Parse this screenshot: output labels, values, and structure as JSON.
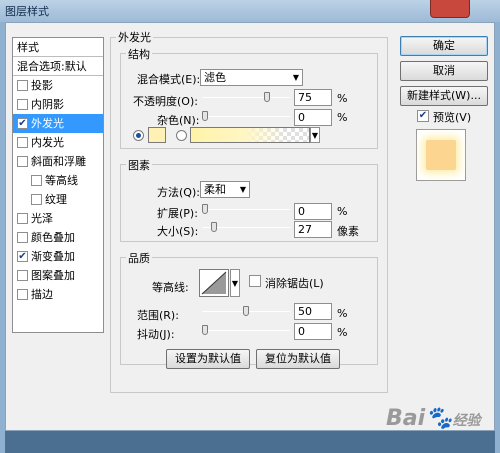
{
  "window": {
    "title": "图层样式"
  },
  "sidebar": {
    "header": "样式",
    "blend_item": "混合选项:默认",
    "items": [
      {
        "label": "投影",
        "checked": false,
        "selected": false,
        "sub": false
      },
      {
        "label": "内阴影",
        "checked": false,
        "selected": false,
        "sub": false
      },
      {
        "label": "外发光",
        "checked": true,
        "selected": true,
        "sub": false
      },
      {
        "label": "内发光",
        "checked": false,
        "selected": false,
        "sub": false
      },
      {
        "label": "斜面和浮雕",
        "checked": false,
        "selected": false,
        "sub": false
      },
      {
        "label": "等高线",
        "checked": false,
        "selected": false,
        "sub": true
      },
      {
        "label": "纹理",
        "checked": false,
        "selected": false,
        "sub": true
      },
      {
        "label": "光泽",
        "checked": false,
        "selected": false,
        "sub": false
      },
      {
        "label": "颜色叠加",
        "checked": false,
        "selected": false,
        "sub": false
      },
      {
        "label": "渐变叠加",
        "checked": true,
        "selected": false,
        "sub": false
      },
      {
        "label": "图案叠加",
        "checked": false,
        "selected": false,
        "sub": false
      },
      {
        "label": "描边",
        "checked": false,
        "selected": false,
        "sub": false
      }
    ]
  },
  "panel": {
    "title": "外发光",
    "structure": {
      "title": "结构",
      "blend_mode_label": "混合模式(E):",
      "blend_mode_value": "滤色",
      "opacity_label": "不透明度(O):",
      "opacity_value": "75",
      "noise_label": "杂色(N):",
      "noise_value": "0",
      "percent": "%",
      "opacity_level": 0.75,
      "noise_level": 0,
      "color": "#fff0b4"
    },
    "elements": {
      "title": "图素",
      "method_label": "方法(Q):",
      "method_value": "柔和",
      "spread_label": "扩展(P):",
      "spread_value": "0",
      "size_label": "大小(S):",
      "size_value": "27",
      "percent": "%",
      "px_unit": "像素",
      "spread_level": 0,
      "size_level": 0.108
    },
    "quality": {
      "title": "品质",
      "contour_label": "等高线:",
      "antialias_label": "消除锯齿(L)",
      "range_label": "范围(R):",
      "range_value": "50",
      "jitter_label": "抖动(J):",
      "jitter_value": "0",
      "percent": "%",
      "range_level": 0.5,
      "jitter_level": 0
    },
    "make_default": "设置为默认值",
    "reset_default": "复位为默认值"
  },
  "buttons": {
    "ok": "确定",
    "cancel": "取消",
    "new_style": "新建样式(W)...",
    "preview": "预览(V)"
  },
  "watermark": {
    "brand": "Bai",
    "brand_suffix": "经验"
  },
  "colors": {
    "selection": "#3399ff",
    "glow": "#fcd590"
  }
}
